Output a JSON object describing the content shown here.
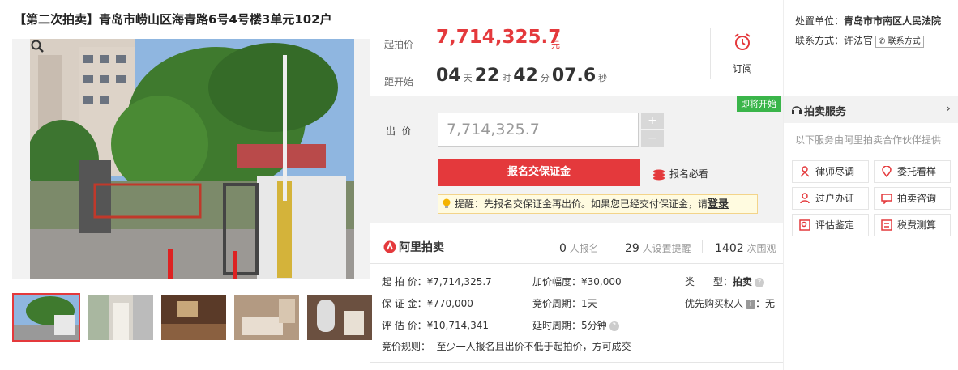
{
  "title": "【第二次拍卖】青岛市崂山区海青路6号4号楼3单元102户",
  "price": {
    "start_label": "起拍价",
    "start_value": "7,714,325.7",
    "currency": "元",
    "countdown_label": "距开始",
    "days": "04",
    "days_unit": "天",
    "hours": "22",
    "hours_unit": "时",
    "minutes": "42",
    "minutes_unit": "分",
    "seconds": "07.6",
    "seconds_unit": "秒"
  },
  "subscribe_label": "订阅",
  "bid": {
    "badge": "即将开始",
    "label": "出  价",
    "placeholder": "7,714,325.7",
    "plus": "+",
    "minus": "−",
    "deposit_button": "报名交保证金",
    "must_read": "报名必看",
    "tip_text": "提醒：先报名交保证金再出价。如果您已经交付保证金，请",
    "tip_link": "登录"
  },
  "brand": "阿里拍卖",
  "stats": {
    "registered": "0",
    "registered_label": "人报名",
    "reminders": "29",
    "reminders_label": "人设置提醒",
    "views": "1402",
    "views_label": "次围观"
  },
  "details": {
    "start_price": "起 拍 价：¥7,714,325.7",
    "increment": "加价幅度：¥30,000",
    "type_label": "类      型：",
    "type_value": "拍卖",
    "deposit": "保 证 金：¥770,000",
    "cycle": "竞价周期：1天",
    "priority_label": "优先购买权人",
    "priority_value": "：无",
    "appraisal": "评 估 价：¥10,714,341",
    "delay": "延时周期：5分钟",
    "rules": "竞价规则：  至少一人报名且出价不低于起拍价，方可成交"
  },
  "court": {
    "unit_label": "处置单位：",
    "unit_value": "青岛市市南区人民法院",
    "contact_label": "联系方式：",
    "contact_value": "许法官",
    "contact_button": "联系方式"
  },
  "services": {
    "title": "拍卖服务",
    "subtitle": "以下服务由阿里拍卖合作伙伴提供",
    "items": [
      "律师尽调",
      "委托看样",
      "过户办证",
      "拍卖咨询",
      "评估鉴定",
      "税费测算"
    ]
  },
  "colors": {
    "accent": "#e4393c",
    "badge_green": "#3ab54a"
  }
}
